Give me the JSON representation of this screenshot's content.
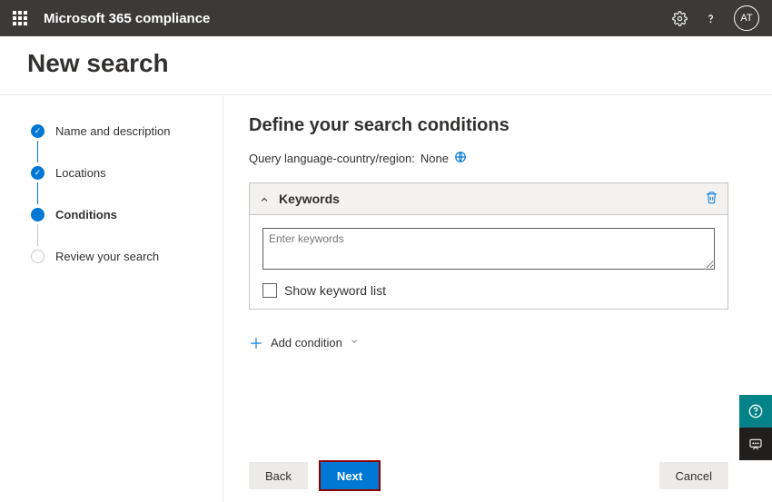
{
  "header": {
    "app_title": "Microsoft 365 compliance",
    "avatar_initials": "AT"
  },
  "page": {
    "title": "New search"
  },
  "sidebar": {
    "steps": [
      {
        "label": "Name and description",
        "state": "done"
      },
      {
        "label": "Locations",
        "state": "done"
      },
      {
        "label": "Conditions",
        "state": "current"
      },
      {
        "label": "Review your search",
        "state": "pending"
      }
    ]
  },
  "main": {
    "title": "Define your search conditions",
    "query_label": "Query language-country/region:",
    "query_value": "None",
    "keywords": {
      "section_title": "Keywords",
      "placeholder": "Enter keywords",
      "value": "",
      "show_list_label": "Show keyword list"
    },
    "add_condition_label": "Add condition"
  },
  "footer": {
    "back": "Back",
    "next": "Next",
    "cancel": "Cancel"
  }
}
